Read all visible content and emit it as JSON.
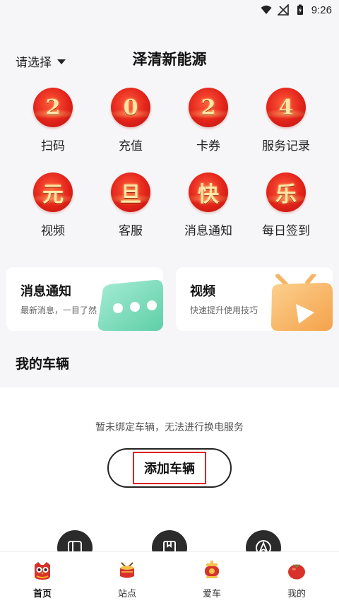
{
  "status_bar": {
    "time": "9:26",
    "icons": [
      "wifi-icon",
      "no-signal-icon",
      "battery-charging-icon"
    ]
  },
  "header": {
    "location_select": "请选择",
    "title": "泽清新能源"
  },
  "grid": [
    {
      "coin_char": "2",
      "label": "扫码",
      "icon": "scan-icon"
    },
    {
      "coin_char": "0",
      "label": "充值",
      "icon": "recharge-icon"
    },
    {
      "coin_char": "2",
      "label": "卡券",
      "icon": "coupon-icon"
    },
    {
      "coin_char": "4",
      "label": "服务记录",
      "icon": "service-record-icon"
    },
    {
      "coin_char": "元",
      "label": "视频",
      "icon": "video-icon"
    },
    {
      "coin_char": "旦",
      "label": "客服",
      "icon": "customer-service-icon"
    },
    {
      "coin_char": "快",
      "label": "消息通知",
      "icon": "notification-icon"
    },
    {
      "coin_char": "乐",
      "label": "每日签到",
      "icon": "daily-checkin-icon"
    }
  ],
  "cards": [
    {
      "title": "消息通知",
      "subtitle": "最新消息，一目了然",
      "illustration": "chat-bubble-icon",
      "color": "#7fdcc0"
    },
    {
      "title": "视频",
      "subtitle": "快速提升使用技巧",
      "illustration": "tv-play-icon",
      "color": "#f7b267"
    }
  ],
  "vehicles": {
    "section_title": "我的车辆",
    "empty_message": "暂未绑定车辆，无法进行换电服务",
    "add_button": "添加车辆"
  },
  "quick_icons": [
    "card-reader-icon",
    "book-icon",
    "navigation-icon"
  ],
  "tabbar": [
    {
      "label": "首页",
      "icon": "home-owl-icon",
      "active": true
    },
    {
      "label": "站点",
      "icon": "station-drum-icon",
      "active": false
    },
    {
      "label": "爱车",
      "icon": "car-lantern-icon",
      "active": false
    },
    {
      "label": "我的",
      "icon": "profile-tomato-icon",
      "active": false
    }
  ],
  "colors": {
    "accent_red": "#e2231a",
    "gold": "#ffe6a8",
    "highlight_box": "#e02020"
  }
}
